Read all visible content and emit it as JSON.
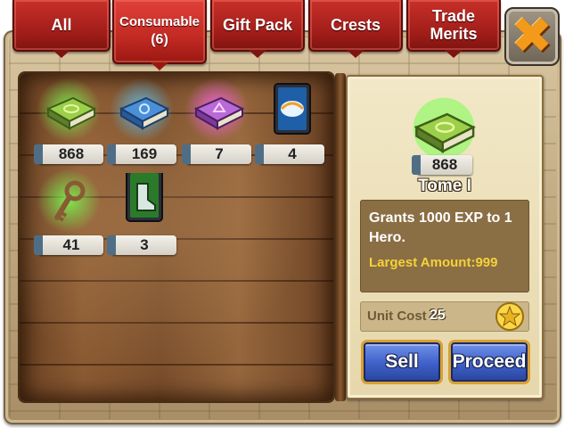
{
  "tabs": [
    {
      "label": "All"
    },
    {
      "label": "Consumable",
      "count": "(6)"
    },
    {
      "label": "Gift Pack"
    },
    {
      "label": "Crests"
    },
    {
      "label": "Trade",
      "label2": "Merits"
    }
  ],
  "items": [
    {
      "name": "tome-green",
      "count": "868"
    },
    {
      "name": "tome-blue",
      "count": "169"
    },
    {
      "name": "tome-purple",
      "count": "7"
    },
    {
      "name": "card-wing",
      "count": "4"
    },
    {
      "name": "key",
      "count": "41"
    },
    {
      "name": "card-boot",
      "count": "3"
    }
  ],
  "detail": {
    "count": "868",
    "name": "Tome I",
    "description": "Grants 1000 EXP to 1 Hero.",
    "largest": "Largest Amount:999",
    "unit_cost_label": "Unit Cost",
    "unit_cost_value": "25"
  },
  "buttons": {
    "sell": "Sell",
    "proceed": "Proceed"
  },
  "colors": {
    "tab_red": "#c22a22",
    "button_blue": "#3e61c8",
    "close_orange": "#f39a1a",
    "highlight_yellow": "#f4d23a"
  }
}
